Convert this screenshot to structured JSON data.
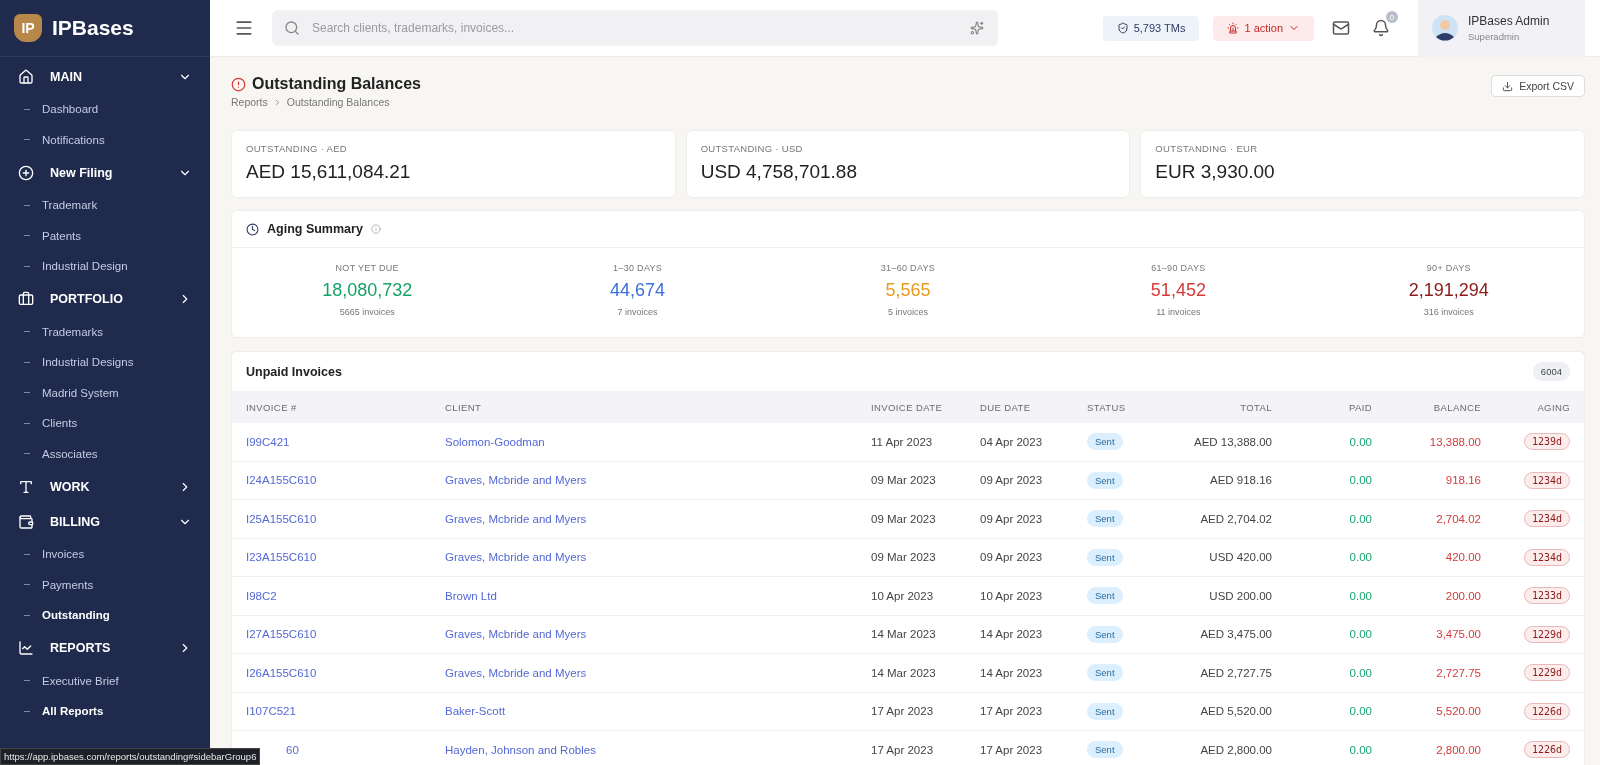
{
  "brand": {
    "logo_mark": "IP",
    "name": "IPBases"
  },
  "sidebar": {
    "groups": [
      {
        "label": "MAIN",
        "expanded": true,
        "items": [
          {
            "label": "Dashboard",
            "selected": false
          },
          {
            "label": "Notifications",
            "selected": false
          }
        ]
      },
      {
        "label": "New Filing",
        "expanded": true,
        "items": [
          {
            "label": "Trademark",
            "selected": false
          },
          {
            "label": "Patents",
            "selected": false
          },
          {
            "label": "Industrial Design",
            "selected": false
          }
        ]
      },
      {
        "label": "PORTFOLIO",
        "expanded": false,
        "items": [
          {
            "label": "Trademarks",
            "selected": false
          },
          {
            "label": "Industrial Designs",
            "selected": false
          },
          {
            "label": "Madrid System",
            "selected": false
          },
          {
            "label": "Clients",
            "selected": false
          },
          {
            "label": "Associates",
            "selected": false
          }
        ]
      },
      {
        "label": "WORK",
        "expanded": false
      },
      {
        "label": "BILLING",
        "expanded": true,
        "items": [
          {
            "label": "Invoices",
            "selected": false
          },
          {
            "label": "Payments",
            "selected": false
          },
          {
            "label": "Outstanding",
            "selected": true
          }
        ]
      },
      {
        "label": "REPORTS",
        "expanded": false,
        "items": [
          {
            "label": "Executive Brief",
            "selected": false
          },
          {
            "label": "All Reports",
            "selected": true
          }
        ]
      }
    ]
  },
  "topbar": {
    "search": {
      "placeholder": "Search clients, trademarks, invoices..."
    },
    "tm_chip": "5,793 TMs",
    "action_chip": "1 action",
    "notification_count": "0",
    "user": {
      "name": "IPBases Admin",
      "role": "Superadmin"
    }
  },
  "page": {
    "title": "Outstanding Balances",
    "breadcrumb": [
      "Reports",
      "Outstanding Balances"
    ],
    "export_button": "Export CSV"
  },
  "totals": [
    {
      "label": "OUTSTANDING · AED",
      "value": "AED 15,611,084.21"
    },
    {
      "label": "OUTSTANDING · USD",
      "value": "USD 4,758,701.88"
    },
    {
      "label": "OUTSTANDING · EUR",
      "value": "EUR 3,930.00"
    }
  ],
  "aging": {
    "title": "Aging Summary",
    "buckets": [
      {
        "label": "NOT YET DUE",
        "value": "18,080,732",
        "count": "5665 invoices",
        "color": "#16a36a"
      },
      {
        "label": "1–30 DAYS",
        "value": "44,674",
        "count": "7 invoices",
        "color": "#3b6fd8"
      },
      {
        "label": "31–60 DAYS",
        "value": "5,565",
        "count": "5 invoices",
        "color": "#e89a1a"
      },
      {
        "label": "61–90 DAYS",
        "value": "51,452",
        "count": "11 invoices",
        "color": "#d63a3a"
      },
      {
        "label": "90+ DAYS",
        "value": "2,191,294",
        "count": "316 invoices",
        "color": "#8b1a1a"
      }
    ]
  },
  "invoices": {
    "title": "Unpaid Invoices",
    "count": "6004",
    "columns": [
      "INVOICE #",
      "CLIENT",
      "INVOICE DATE",
      "DUE DATE",
      "STATUS",
      "TOTAL",
      "PAID",
      "BALANCE",
      "AGING"
    ],
    "rows": [
      {
        "invoice": "I99C421",
        "client": "Solomon-Goodman",
        "invoice_date": "11 Apr 2023",
        "due_date": "04 Apr 2023",
        "status": "Sent",
        "total": "AED 13,388.00",
        "paid": "0.00",
        "balance": "13,388.00",
        "aging": "1239d"
      },
      {
        "invoice": "I24A155C610",
        "client": "Graves, Mcbride and Myers",
        "invoice_date": "09 Mar 2023",
        "due_date": "09 Apr 2023",
        "status": "Sent",
        "total": "AED 918.16",
        "paid": "0.00",
        "balance": "918.16",
        "aging": "1234d"
      },
      {
        "invoice": "I25A155C610",
        "client": "Graves, Mcbride and Myers",
        "invoice_date": "09 Mar 2023",
        "due_date": "09 Apr 2023",
        "status": "Sent",
        "total": "AED 2,704.02",
        "paid": "0.00",
        "balance": "2,704.02",
        "aging": "1234d"
      },
      {
        "invoice": "I23A155C610",
        "client": "Graves, Mcbride and Myers",
        "invoice_date": "09 Mar 2023",
        "due_date": "09 Apr 2023",
        "status": "Sent",
        "total": "USD 420.00",
        "paid": "0.00",
        "balance": "420.00",
        "aging": "1234d"
      },
      {
        "invoice": "I98C2",
        "client": "Brown Ltd",
        "invoice_date": "10 Apr 2023",
        "due_date": "10 Apr 2023",
        "status": "Sent",
        "total": "USD 200.00",
        "paid": "0.00",
        "balance": "200.00",
        "aging": "1233d"
      },
      {
        "invoice": "I27A155C610",
        "client": "Graves, Mcbride and Myers",
        "invoice_date": "14 Mar 2023",
        "due_date": "14 Apr 2023",
        "status": "Sent",
        "total": "AED 3,475.00",
        "paid": "0.00",
        "balance": "3,475.00",
        "aging": "1229d"
      },
      {
        "invoice": "I26A155C610",
        "client": "Graves, Mcbride and Myers",
        "invoice_date": "14 Mar 2023",
        "due_date": "14 Apr 2023",
        "status": "Sent",
        "total": "AED 2,727.75",
        "paid": "0.00",
        "balance": "2,727.75",
        "aging": "1229d"
      },
      {
        "invoice": "I107C521",
        "client": "Baker-Scott",
        "invoice_date": "17 Apr 2023",
        "due_date": "17 Apr 2023",
        "status": "Sent",
        "total": "AED 5,520.00",
        "paid": "0.00",
        "balance": "5,520.00",
        "aging": "1226d"
      },
      {
        "invoice": "60",
        "covered": true,
        "client": "Hayden, Johnson and Robles",
        "invoice_date": "17 Apr 2023",
        "due_date": "17 Apr 2023",
        "status": "Sent",
        "total": "AED 2,800.00",
        "paid": "0.00",
        "balance": "2,800.00",
        "aging": "1226d"
      }
    ]
  },
  "status_url": "https://app.ipbases.com/reports/outstanding#sidebarGroup6"
}
